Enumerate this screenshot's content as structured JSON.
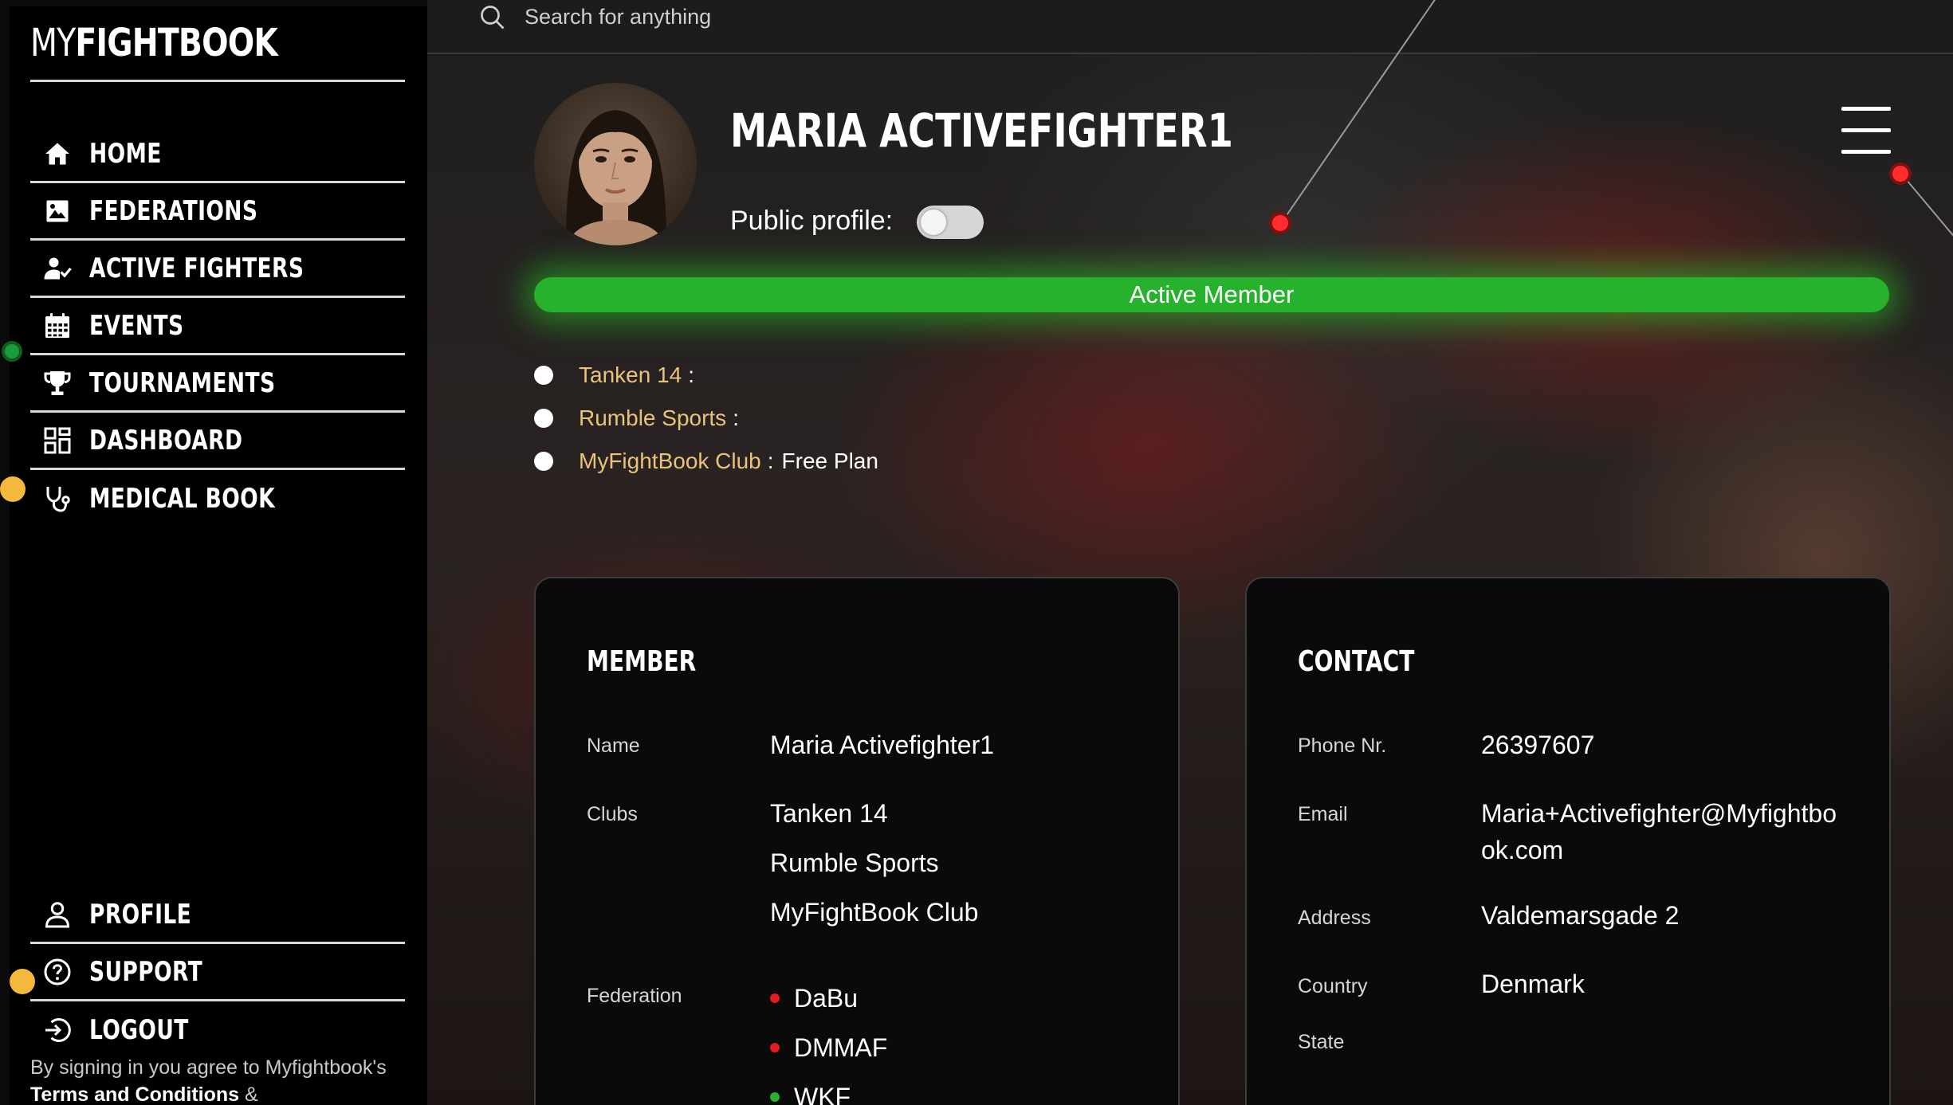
{
  "app": {
    "logo_light": "MY",
    "logo_bold": "FIGHTBOOK"
  },
  "sidebar": {
    "items": [
      {
        "label": "HOME",
        "icon": "home-icon"
      },
      {
        "label": "FEDERATIONS",
        "icon": "image-icon"
      },
      {
        "label": "ACTIVE FIGHTERS",
        "icon": "user-check-icon"
      },
      {
        "label": "EVENTS",
        "icon": "calendar-icon"
      },
      {
        "label": "TOURNAMENTS",
        "icon": "trophy-icon"
      },
      {
        "label": "DASHBOARD",
        "icon": "dashboard-icon"
      },
      {
        "label": "MEDICAL BOOK",
        "icon": "stethoscope-icon"
      }
    ],
    "bottom_items": [
      {
        "label": "PROFILE",
        "icon": "user-icon"
      },
      {
        "label": "SUPPORT",
        "icon": "help-icon"
      },
      {
        "label": "LOGOUT",
        "icon": "logout-icon"
      }
    ],
    "terms_prefix": "By signing in you agree to Myfightbook's",
    "terms_link": "Terms and Conditions",
    "terms_suffix": "&"
  },
  "search": {
    "placeholder": "Search for anything"
  },
  "profile": {
    "name": "MARIA ACTIVEFIGHTER1",
    "public_label": "Public profile:",
    "public_enabled": false,
    "status": "Active Member",
    "status_color": "#27b22e"
  },
  "clubs": [
    {
      "name": "Tanken 14",
      "plan": ""
    },
    {
      "name": "Rumble Sports",
      "plan": ""
    },
    {
      "name": "MyFightBook Club",
      "plan": "Free Plan"
    }
  ],
  "member": {
    "title": "MEMBER",
    "name_label": "Name",
    "name_value": "Maria Activefighter1",
    "clubs_label": "Clubs",
    "clubs": [
      "Tanken 14",
      "Rumble Sports",
      "MyFightBook Club"
    ],
    "federation_label": "Federation",
    "federations": [
      {
        "name": "DaBu",
        "color": "#e21b23"
      },
      {
        "name": "DMMAF",
        "color": "#e21b23"
      },
      {
        "name": "WKF",
        "color": "#27b22e"
      }
    ]
  },
  "contact": {
    "title": "CONTACT",
    "phone_label": "Phone Nr.",
    "phone_value": "26397607",
    "email_label": "Email",
    "email_value": "Maria+Activefighter@Myfightbook.com",
    "address_label": "Address",
    "address_value": "Valdemarsgade 2",
    "country_label": "Country",
    "country_value": "Denmark",
    "state_label": "State"
  },
  "colors": {
    "accent_green": "#27b22e",
    "club_link": "#e9c37a",
    "marker_red": "#ff2d2d",
    "marker_yellow": "#f4b93b"
  }
}
